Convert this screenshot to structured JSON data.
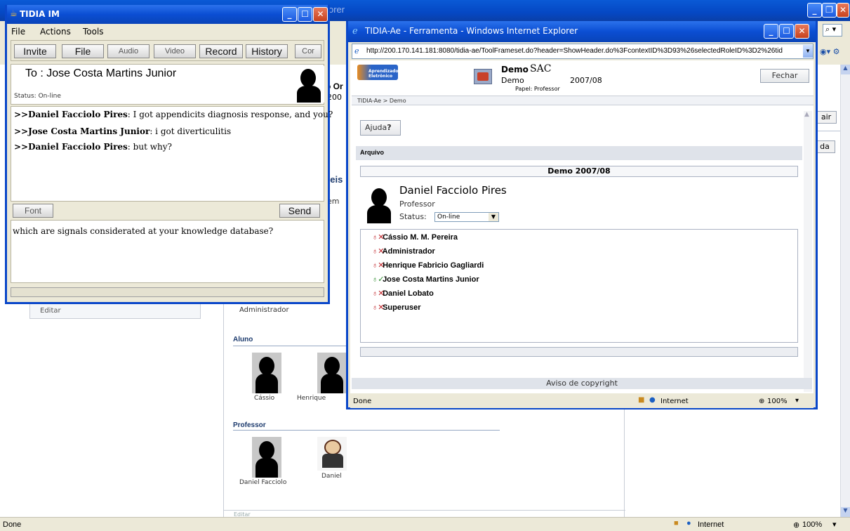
{
  "background_window": {
    "title_fragment": "orer",
    "status_done": "Done",
    "status_zone": "Internet",
    "status_zoom": "100%",
    "partial_texts": [
      "o Or",
      "200",
      "veis",
      "em",
      "air",
      "da"
    ],
    "left_panel_edit": "Editar",
    "administrador_caption": "Administrador",
    "aluno_section": "Aluno",
    "aluno_members": [
      "Cássio",
      "Henrique"
    ],
    "professor_section": "Professor",
    "professor_members": [
      "Daniel Facciolo",
      "Daniel"
    ],
    "bottom_partial": "Editar"
  },
  "ie_popup": {
    "title": "TIDIA-Ae - Ferramenta - Windows Internet Explorer",
    "address": "http://200.170.141.181:8080/tidia-ae/ToolFrameset.do?header=ShowHeader.do%3FcontextID%3D93%26selectedRoleID%3D2%26tid",
    "logo_text": "Aprendizado Eletrônico",
    "course_name": "Demo",
    "course_code": "SAC",
    "course_sub": "Demo",
    "course_year": "2007/08",
    "role": "Papel: Professor",
    "close_button": "Fechar",
    "breadcrumb": "TIDIA-Ae > Demo",
    "help_button": "Ajuda",
    "help_icon": "?",
    "section_title": "Arquivo",
    "group_title": "Demo  2007/08",
    "user_name": "Daniel Facciolo  Pires",
    "user_role": "Professor",
    "status_label": "Status:",
    "status_value": "On-line",
    "contacts": [
      {
        "name": "Cássio M. M. Pereira",
        "state": "offline"
      },
      {
        "name": "Administrador",
        "state": "offline"
      },
      {
        "name": "Henrique Fabricio Gagliardi",
        "state": "offline"
      },
      {
        "name": "Jose Costa Martins Junior",
        "state": "online"
      },
      {
        "name": "Daniel Lobato",
        "state": "offline"
      },
      {
        "name": "Superuser",
        "state": "offline"
      }
    ],
    "copyright": "Aviso de copyright",
    "status_done": "Done",
    "status_zone": "Internet",
    "status_zoom": "100%",
    "colors": {
      "online": "#2a8a2a",
      "offline": "#c0262b"
    }
  },
  "im_window": {
    "title": "TIDIA IM",
    "menu": [
      "File",
      "Actions",
      "Tools"
    ],
    "toolbar": {
      "invite": "Invite",
      "file": "File",
      "audio": "Audio",
      "video": "Video",
      "record": "Record",
      "history": "History",
      "cor": "Cor"
    },
    "to_label": "To : Jose Costa Martins Junior",
    "status": "Status: On-line",
    "messages": [
      {
        "sender": ">>Daniel Facciolo Pires",
        "text": ":  I got appendicits diagnosis response, and you?"
      },
      {
        "sender": ">>Jose Costa Martins Junior",
        "text": ":  i got diverticulitis"
      },
      {
        "sender": ">>Daniel Facciolo Pires",
        "text": ":  but why?"
      }
    ],
    "font_button": "Font",
    "send_button": "Send",
    "compose_text": "which are signals considerated at your knowledge database?"
  }
}
